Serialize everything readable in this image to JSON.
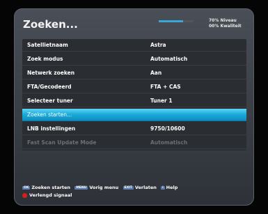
{
  "screen": {
    "title": "Zoeken..."
  },
  "signal": {
    "level_percent": 70,
    "level_label": "70% Niveau",
    "quality_percent": 0,
    "quality_label": "00% Kwaliteit"
  },
  "menu": {
    "rows": [
      {
        "label": "Satellietnaam",
        "value": "Astra"
      },
      {
        "label": "Zoek modus",
        "value": "Automatisch"
      },
      {
        "label": "Netwerk zoeken",
        "value": "Aan"
      },
      {
        "label": "FTA/Gecodeerd",
        "value": "FTA + CAS"
      },
      {
        "label": "Selecteer tuner",
        "value": "Tuner 1"
      },
      {
        "label": "Zoeken starten...",
        "value": ""
      },
      {
        "label": "LNB instellingen",
        "value": "9750/10600"
      },
      {
        "label": "Fast Scan Update Mode",
        "value": "Automatisch"
      }
    ]
  },
  "footer": {
    "keys": [
      {
        "key": "OK",
        "action": "Zoeken starten"
      },
      {
        "key": "MENU",
        "action": "Vorig menu"
      },
      {
        "key": "EXIT",
        "action": "Verlaten"
      },
      {
        "key": "i",
        "action": "Help"
      }
    ],
    "red_action": "Verlengd signaal"
  },
  "colors": {
    "highlight": "#18a9d8",
    "panel": "#3c4148",
    "red": "#d62020"
  }
}
